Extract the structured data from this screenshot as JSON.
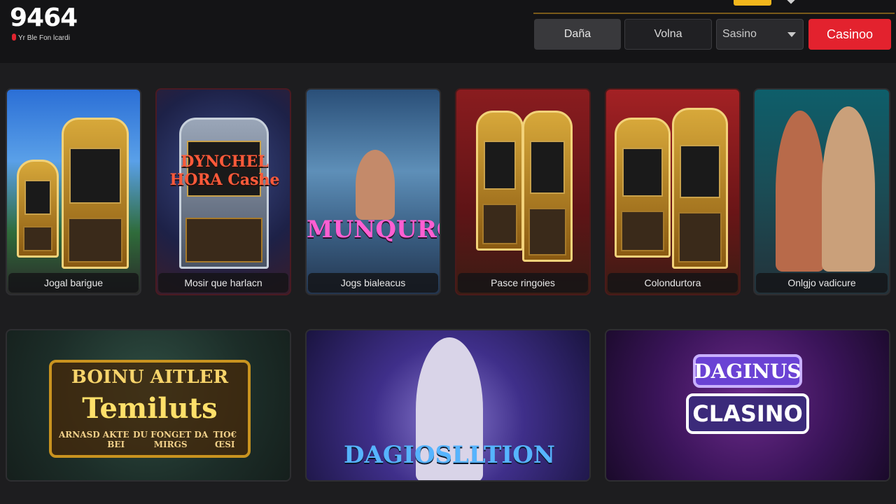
{
  "brand": {
    "name": "9464",
    "tagline": "Yr Ble Fon lcardi"
  },
  "nav": {
    "item1": "Daña",
    "item2": "Volna",
    "select_value": "Sasino",
    "cta": "Casinoo"
  },
  "colors": {
    "accent": "#e3222e",
    "background": "#1d1d1f",
    "header": "#141416",
    "gold": "#f2b61c"
  },
  "games_row1": [
    {
      "caption": "Jogal barigue"
    },
    {
      "caption": "Mosir que harlacn",
      "banner": "DYNCHEL HORA Cashe"
    },
    {
      "caption": "Jogs bialeacus",
      "banner": "MUNQURO"
    },
    {
      "caption": "Pasce ringoies"
    },
    {
      "caption": "Colondurtora"
    },
    {
      "caption": "Onlgjo vadicure"
    }
  ],
  "games_row2": [
    {
      "banner_small": "BOINU AITLER",
      "banner_big": "Temiluts",
      "footer": [
        "ARNASD",
        "AKTE BEI",
        "DU FONGET DA MIRGS",
        "TIO€ ŒSI"
      ]
    },
    {
      "banner": "DAGIOSLLTION"
    },
    {
      "banner_top": "DAGINUS",
      "banner_main": "CLASINO"
    }
  ]
}
